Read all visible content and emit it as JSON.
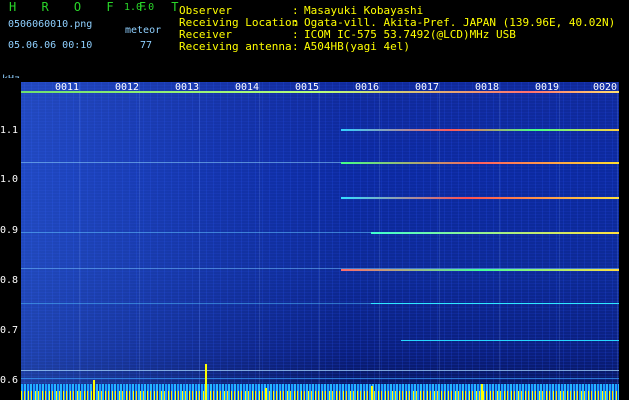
{
  "header": {
    "app_title": "H R O F F T",
    "app_version": "1.0.0",
    "file_name": "0506060010.png",
    "mode": "meteor",
    "datetime": "05.06.06 00:10",
    "count": "77",
    "info": [
      {
        "label": "Observer",
        "value": "Masayuki Kobayashi"
      },
      {
        "label": "Receiving Location",
        "value": "Ogata-vill. Akita-Pref. JAPAN (139.96E, 40.02N)"
      },
      {
        "label": "Receiver",
        "value": "ICOM IC-575 53.7492(@LCD)MHz USB"
      },
      {
        "label": "Receiving antenna",
        "value": "A504HB(yagi 4el)"
      }
    ],
    "colon": ":"
  },
  "axis": {
    "unit": "kHz",
    "y_ticks": [
      "1.1",
      "1.0",
      "0.9",
      "0.8",
      "0.7",
      "0.6"
    ],
    "minutes": [
      "0011",
      "0012",
      "0013",
      "0014",
      "0015",
      "0016",
      "0017",
      "0018",
      "0019",
      "0020"
    ]
  },
  "colors": {
    "title_green": "#29d629",
    "info_yellow": "#ffff00",
    "label_blue": "#8fd0ff",
    "spectrum_base": "#0c2aa0"
  }
}
